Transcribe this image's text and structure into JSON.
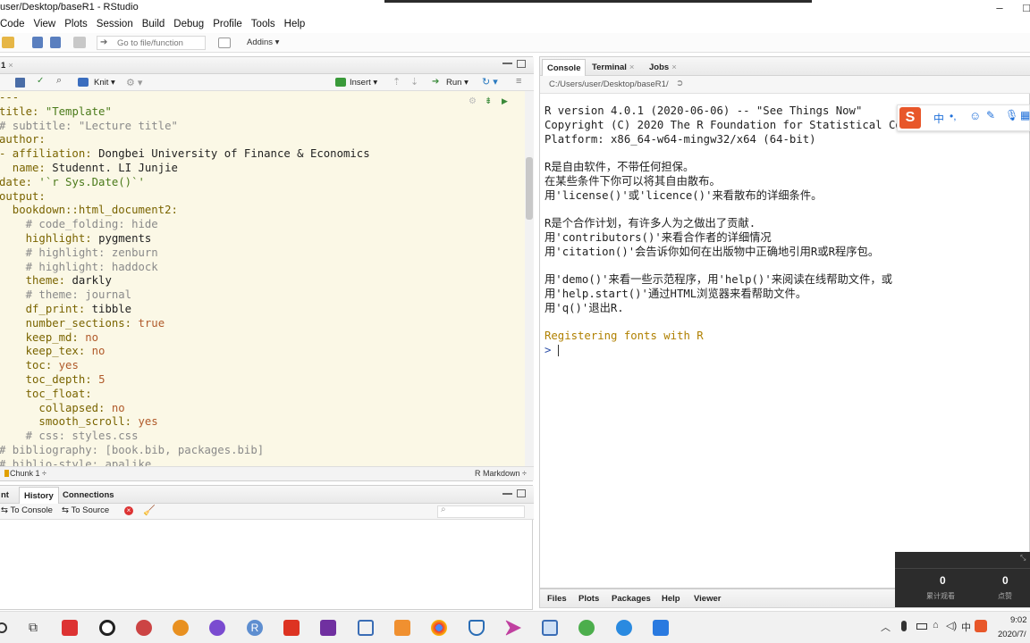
{
  "window": {
    "title": "user/Desktop/baseR1 - RStudio"
  },
  "menu": [
    "Code",
    "View",
    "Plots",
    "Session",
    "Build",
    "Debug",
    "Profile",
    "Tools",
    "Help"
  ],
  "toolbar": {
    "goto_placeholder": "Go to file/function",
    "addins_label": "Addins ▾"
  },
  "editor": {
    "tab_label": "1",
    "knit_label": "Knit",
    "insert_label": "Insert",
    "run_label": "Run",
    "lines": [
      [
        [
          "k",
          "---"
        ]
      ],
      [
        [
          "k",
          "title: "
        ],
        [
          "s",
          "\"Template\""
        ]
      ],
      [
        [
          "c",
          "# subtitle: \"Lecture title\""
        ]
      ],
      [
        [
          "k",
          "author:"
        ]
      ],
      [
        [
          "k",
          "- affiliation: "
        ],
        [
          "v",
          "Dongbei University of Finance & Economics"
        ]
      ],
      [
        [
          "k",
          "  name: "
        ],
        [
          "v",
          "Studennt. LI Junjie"
        ]
      ],
      [
        [
          "k",
          "date: "
        ],
        [
          "s",
          "'`r Sys.Date()`'"
        ]
      ],
      [
        [
          "k",
          "output:"
        ]
      ],
      [
        [
          "k",
          "  bookdown::html_document2:"
        ]
      ],
      [
        [
          "c",
          "    # code_folding: hide"
        ]
      ],
      [
        [
          "k",
          "    highlight: "
        ],
        [
          "v",
          "pygments"
        ]
      ],
      [
        [
          "c",
          "    # highlight: zenburn"
        ]
      ],
      [
        [
          "c",
          "    # highlight: haddock"
        ]
      ],
      [
        [
          "k",
          "    theme: "
        ],
        [
          "v",
          "darkly"
        ]
      ],
      [
        [
          "c",
          "    # theme: journal"
        ]
      ],
      [
        [
          "k",
          "    df_print: "
        ],
        [
          "v",
          "tibble"
        ]
      ],
      [
        [
          "k",
          "    number_sections: "
        ],
        [
          "n",
          "true"
        ]
      ],
      [
        [
          "k",
          "    keep_md: "
        ],
        [
          "n",
          "no"
        ]
      ],
      [
        [
          "k",
          "    keep_tex: "
        ],
        [
          "n",
          "no"
        ]
      ],
      [
        [
          "k",
          "    toc: "
        ],
        [
          "n",
          "yes"
        ]
      ],
      [
        [
          "k",
          "    toc_depth: "
        ],
        [
          "n",
          "5"
        ]
      ],
      [
        [
          "k",
          "    toc_float:"
        ]
      ],
      [
        [
          "k",
          "      collapsed: "
        ],
        [
          "n",
          "no"
        ]
      ],
      [
        [
          "k",
          "      smooth_scroll: "
        ],
        [
          "n",
          "yes"
        ]
      ],
      [
        [
          "c",
          "    # css: styles.css"
        ]
      ],
      [
        [
          "c",
          "# bibliography: [book.bib, packages.bib]"
        ]
      ],
      [
        [
          "c",
          "# biblio-style: apalike"
        ]
      ]
    ],
    "status_position": "Chunk 1 ÷",
    "status_mode": "R Markdown ÷"
  },
  "history_pane": {
    "tabs": [
      "nt",
      "History",
      "Connections"
    ],
    "to_console": "To Console",
    "to_source": "To Source"
  },
  "console": {
    "tabs": [
      "Console",
      "Terminal",
      "Jobs"
    ],
    "path": "C:/Users/user/Desktop/baseR1/",
    "lines": [
      "R version 4.0.1 (2020-06-06) -- \"See Things Now\"",
      "Copyright (C) 2020 The R Foundation for Statistical Computing",
      "Platform: x86_64-w64-mingw32/x64 (64-bit)",
      "",
      "R是自由软件，不带任何担保。",
      "在某些条件下你可以将其自由散布。",
      "用'license()'或'licence()'来看散布的详细条件。",
      "",
      "R是个合作计划，有许多人为之做出了贡献.",
      "用'contributors()'来看合作者的详细情况",
      "用'citation()'会告诉你如何在出版物中正确地引用R或R程序包。",
      "",
      "用'demo()'来看一些示范程序，用'help()'来阅读在线帮助文件，或",
      "用'help.start()'通过HTML浏览器来看帮助文件。",
      "用'q()'退出R.",
      ""
    ],
    "registering": "Registering fonts with R",
    "prompt": "> "
  },
  "bottom_tabs": [
    "Files",
    "Plots",
    "Packages",
    "Help",
    "Viewer"
  ],
  "ime_bar": {
    "mode": "中"
  },
  "overlay": {
    "left_value": "0",
    "left_label": "累计观看",
    "right_value": "0",
    "right_label": "点赞"
  },
  "tray": {
    "time": "9:02",
    "date": "2020/7/",
    "ime": "中"
  }
}
